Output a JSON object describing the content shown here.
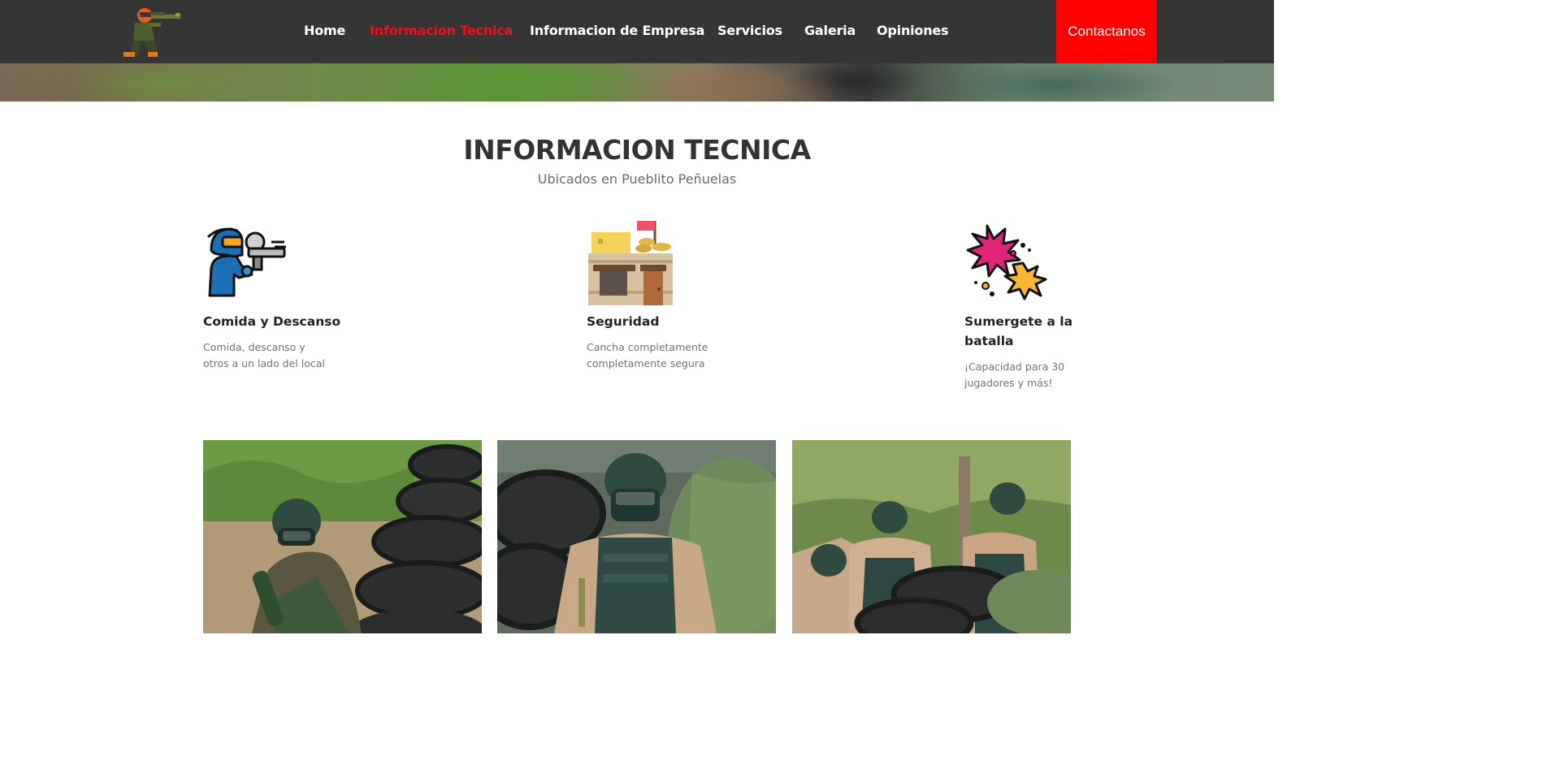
{
  "nav": {
    "logo_icon": "paintball-player-logo-icon",
    "items": [
      {
        "label": "Home",
        "active": false
      },
      {
        "label": "Informacion Tecnica",
        "active": true
      },
      {
        "label": "Informacion de Empresa",
        "active": false
      },
      {
        "label": "Servicios",
        "active": false
      },
      {
        "label": "Galeria",
        "active": false
      },
      {
        "label": "Opiniones",
        "active": false
      }
    ],
    "contact_label": "Contactanos",
    "colors": {
      "bar": "#353535",
      "active": "#e8141b",
      "contact_bg": "#ff0000"
    }
  },
  "section": {
    "title": "INFORMACION TECNICA",
    "subtitle": "Ubicados en Pueblito Peñuelas"
  },
  "features": [
    {
      "icon": "paintball-player-icon",
      "title": "Comida y Descanso",
      "text": "Comida, descanso y otros a un lado del local"
    },
    {
      "icon": "bunker-flag-icon",
      "title": "Seguridad",
      "text": "Cancha completamente completamente segura"
    },
    {
      "icon": "paint-splatter-icon",
      "title": "Sumergete a la batalla",
      "text": "¡Capacidad para 30 jugadores y más!"
    }
  ],
  "gallery": [
    {
      "image": "paintball-player-crouching-by-tires-photo"
    },
    {
      "image": "paintball-player-standing-by-tires-photo"
    },
    {
      "image": "paintball-team-behind-tires-photo"
    }
  ]
}
